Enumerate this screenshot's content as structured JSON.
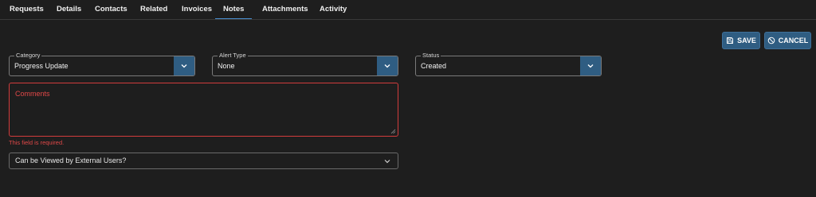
{
  "tabs": [
    {
      "label": "Requests"
    },
    {
      "label": "Details"
    },
    {
      "label": "Contacts"
    },
    {
      "label": "Related"
    },
    {
      "label": "Invoices"
    },
    {
      "label": "Notes",
      "active": true
    },
    {
      "label": "Attachments"
    },
    {
      "label": "Activity"
    }
  ],
  "actions": {
    "save_label": "SAVE",
    "cancel_label": "CANCEL"
  },
  "form": {
    "category": {
      "label": "Category",
      "value": "Progress Update"
    },
    "alert_type": {
      "label": "Alert Type",
      "value": "None"
    },
    "status": {
      "label": "Status",
      "value": "Created"
    },
    "comments": {
      "placeholder": "Comments",
      "value": "",
      "error": "This field is required."
    },
    "external_visibility": {
      "label": "Can be Viewed by External Users?"
    }
  },
  "icons": {
    "save": "save-icon",
    "cancel": "cancel-circle-icon",
    "dropdown": "chevron-down-icon"
  },
  "colors": {
    "background": "#1e1e1e",
    "accent": "#2f5d82",
    "error": "#e04848",
    "active_tab_underline": "#4a8fd0"
  }
}
